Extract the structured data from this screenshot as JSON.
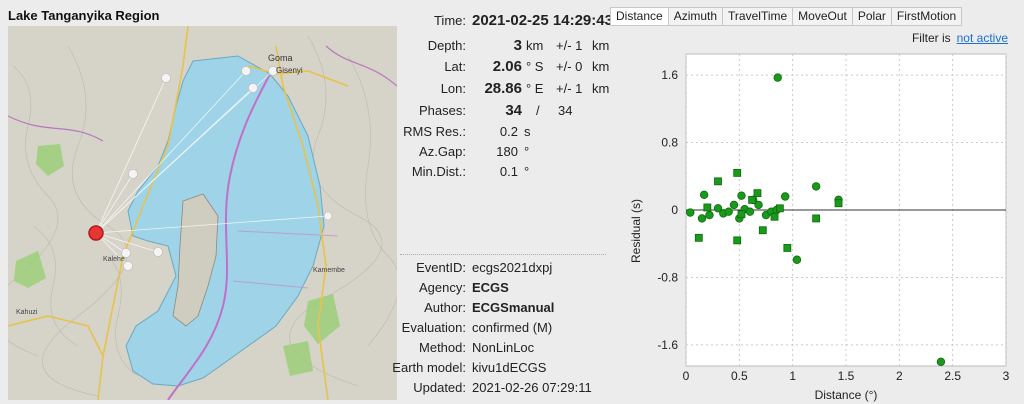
{
  "map": {
    "title": "Lake Tanganyika Region",
    "place_labels": [
      "Goma",
      "Gisenyi",
      "Kalehe",
      "Kamembe",
      "Kahuzi"
    ]
  },
  "details": {
    "time": {
      "label": "Time:",
      "value": "2021-02-25 14:29:43"
    },
    "depth": {
      "label": "Depth:",
      "value": "3",
      "unit": "km",
      "err": "+/- 1",
      "err_unit": "km"
    },
    "lat": {
      "label": "Lat:",
      "value": "2.06",
      "unit": "° S",
      "err": "+/- 0",
      "err_unit": "km"
    },
    "lon": {
      "label": "Lon:",
      "value": "28.86",
      "unit": "° E",
      "err": "+/- 1",
      "err_unit": "km"
    },
    "phases": {
      "label": "Phases:",
      "value": "34",
      "sep": "/",
      "total": "34"
    },
    "rms": {
      "label": "RMS Res.:",
      "value": "0.2",
      "unit": "s"
    },
    "azgap": {
      "label": "Az.Gap:",
      "value": "180",
      "unit": "°"
    },
    "mindist": {
      "label": "Min.Dist.:",
      "value": "0.1",
      "unit": "°"
    },
    "eventid": {
      "label": "EventID:",
      "value": "ecgs2021dxpj"
    },
    "agency": {
      "label": "Agency:",
      "value": "ECGS"
    },
    "author": {
      "label": "Author:",
      "value": "ECGSmanual"
    },
    "evaluation": {
      "label": "Evaluation:",
      "value": "confirmed (M)"
    },
    "method": {
      "label": "Method:",
      "value": "NonLinLoc"
    },
    "earthmodel": {
      "label": "Earth model:",
      "value": "kivu1dECGS"
    },
    "updated": {
      "label": "Updated:",
      "value": "2021-02-26 07:29:11"
    }
  },
  "tabs": [
    "Distance",
    "Azimuth",
    "TravelTime",
    "MoveOut",
    "Polar",
    "FirstMotion"
  ],
  "active_tab": "Distance",
  "filter": {
    "label": "Filter is",
    "link": "not active"
  },
  "chart_data": {
    "type": "scatter",
    "xlabel": "Distance (°)",
    "ylabel": "Residual (s)",
    "xlim": [
      0,
      3
    ],
    "ylim": [
      -1.85,
      1.85
    ],
    "xticks": [
      "0",
      "0.5",
      "1",
      "1.5",
      "2",
      "2.5",
      "3"
    ],
    "yticks": [
      "1.6",
      "0.8",
      "0",
      "-0.8",
      "-1.6"
    ],
    "grid": true,
    "color": "#1a9a1a",
    "series": [
      {
        "marker": "circle",
        "points": [
          [
            0.04,
            -0.03
          ],
          [
            0.15,
            -0.1
          ],
          [
            0.17,
            0.18
          ],
          [
            0.22,
            -0.06
          ],
          [
            0.3,
            0.02
          ],
          [
            0.35,
            -0.04
          ],
          [
            0.4,
            -0.02
          ],
          [
            0.45,
            0.06
          ],
          [
            0.5,
            -0.1
          ],
          [
            0.52,
            0.17
          ],
          [
            0.55,
            0.01
          ],
          [
            0.6,
            -0.02
          ],
          [
            0.63,
            0.12
          ],
          [
            0.68,
            0.06
          ],
          [
            0.75,
            -0.06
          ],
          [
            0.8,
            -0.02
          ],
          [
            0.85,
            0.0
          ],
          [
            0.86,
            1.57
          ],
          [
            0.93,
            0.16
          ],
          [
            1.04,
            -0.59
          ],
          [
            1.22,
            0.28
          ],
          [
            1.43,
            0.12
          ],
          [
            2.39,
            -1.8
          ]
        ]
      },
      {
        "marker": "square",
        "points": [
          [
            0.12,
            -0.33
          ],
          [
            0.2,
            0.03
          ],
          [
            0.3,
            0.34
          ],
          [
            0.48,
            -0.36
          ],
          [
            0.48,
            0.44
          ],
          [
            0.52,
            -0.05
          ],
          [
            0.62,
            0.12
          ],
          [
            0.67,
            0.2
          ],
          [
            0.72,
            -0.24
          ],
          [
            0.83,
            -0.08
          ],
          [
            0.88,
            0.02
          ],
          [
            0.95,
            -0.45
          ],
          [
            1.22,
            -0.1
          ],
          [
            1.43,
            0.08
          ]
        ]
      }
    ]
  }
}
